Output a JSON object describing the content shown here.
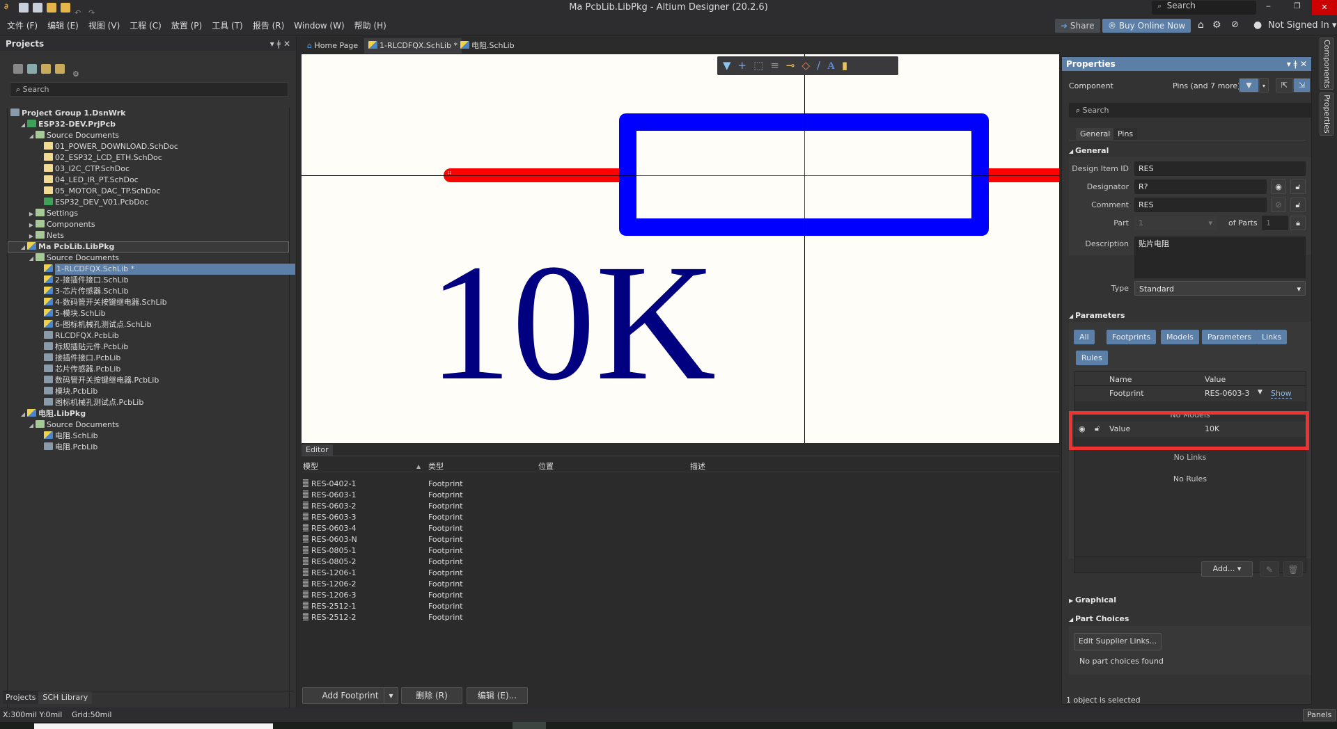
{
  "app": {
    "title": "Ma PcbLib.LibPkg - Altium Designer (20.2.6)",
    "search_placeholder": "Search"
  },
  "menu": [
    "文件 (F)",
    "编辑 (E)",
    "视图 (V)",
    "工程 (C)",
    "放置 (P)",
    "工具 (T)",
    "报告 (R)",
    "Window (W)",
    "帮助 (H)"
  ],
  "topbar": {
    "share": "Share",
    "buy": "Buy Online Now",
    "user": "Not Signed In"
  },
  "projects": {
    "title": "Projects",
    "search_placeholder": "Search",
    "tree": [
      {
        "label": "Project Group 1.DsnWrk",
        "level": 0,
        "icon": "project-group",
        "bold": true
      },
      {
        "label": "ESP32-DEV.PrjPcb",
        "level": 1,
        "icon": "pcb-project",
        "arrow": "open",
        "bold": true
      },
      {
        "label": "Source Documents",
        "level": 2,
        "icon": "folder",
        "arrow": "open"
      },
      {
        "label": "01_POWER_DOWNLOAD.SchDoc",
        "level": 3,
        "icon": "schdoc"
      },
      {
        "label": "02_ESP32_LCD_ETH.SchDoc",
        "level": 3,
        "icon": "schdoc"
      },
      {
        "label": "03_I2C_CTP.SchDoc",
        "level": 3,
        "icon": "schdoc"
      },
      {
        "label": "04_LED_IR_PT.SchDoc",
        "level": 3,
        "icon": "schdoc"
      },
      {
        "label": "05_MOTOR_DAC_TP.SchDoc",
        "level": 3,
        "icon": "schdoc"
      },
      {
        "label": "ESP32_DEV_V01.PcbDoc",
        "level": 3,
        "icon": "pcbdoc"
      },
      {
        "label": "Settings",
        "level": 2,
        "icon": "folder",
        "arrow": "closed"
      },
      {
        "label": "Components",
        "level": 2,
        "icon": "folder",
        "arrow": "closed"
      },
      {
        "label": "Nets",
        "level": 2,
        "icon": "folder",
        "arrow": "closed"
      },
      {
        "label": "Ma PcbLib.LibPkg",
        "level": 1,
        "icon": "libpkg",
        "arrow": "open",
        "bold": true,
        "outlined": true
      },
      {
        "label": "Source Documents",
        "level": 2,
        "icon": "folder",
        "arrow": "open"
      },
      {
        "label": "1-RLCDFQX.SchLib *",
        "level": 3,
        "icon": "schlib",
        "selected": true
      },
      {
        "label": "2-接插件接口.SchLib",
        "level": 3,
        "icon": "schlib"
      },
      {
        "label": "3-芯片传感器.SchLib",
        "level": 3,
        "icon": "schlib"
      },
      {
        "label": "4-数码管开关按键继电器.SchLib",
        "level": 3,
        "icon": "schlib"
      },
      {
        "label": "5-模块.SchLib",
        "level": 3,
        "icon": "schlib"
      },
      {
        "label": "6-图标机械孔测试点.SchLib",
        "level": 3,
        "icon": "schlib"
      },
      {
        "label": "RLCDFQX.PcbLib",
        "level": 3,
        "icon": "pcblib"
      },
      {
        "label": "标规插贴元件.PcbLib",
        "level": 3,
        "icon": "pcblib"
      },
      {
        "label": "接插件接口.PcbLib",
        "level": 3,
        "icon": "pcblib"
      },
      {
        "label": "芯片传感器.PcbLib",
        "level": 3,
        "icon": "pcblib"
      },
      {
        "label": "数码管开关按键继电器.PcbLib",
        "level": 3,
        "icon": "pcblib"
      },
      {
        "label": "模块.PcbLib",
        "level": 3,
        "icon": "pcblib"
      },
      {
        "label": "图标机械孔测试点.PcbLib",
        "level": 3,
        "icon": "pcblib"
      },
      {
        "label": "电阻.LibPkg",
        "level": 1,
        "icon": "libpkg",
        "arrow": "open",
        "bold": true
      },
      {
        "label": "Source Documents",
        "level": 2,
        "icon": "folder",
        "arrow": "open"
      },
      {
        "label": "电阻.SchLib",
        "level": 3,
        "icon": "schlib"
      },
      {
        "label": "电阻.PcbLib",
        "level": 3,
        "icon": "pcblib"
      }
    ],
    "bottom_tabs": [
      "Projects",
      "SCH Library"
    ]
  },
  "doc_tabs": [
    {
      "label": "Home Page",
      "icon": "home"
    },
    {
      "label": "1-RLCDFQX.SchLib *",
      "icon": "schlib",
      "active": true
    },
    {
      "label": "电阻.SchLib",
      "icon": "schlib"
    }
  ],
  "canvas": {
    "value_text": "10K",
    "colors": {
      "pin": "#ff0000",
      "body": "#0000ff",
      "text": "#000080"
    }
  },
  "editor": {
    "tab": "Editor",
    "columns": [
      "模型",
      "类型",
      "位置",
      "描述"
    ],
    "rows": [
      [
        "RES-0402-1",
        "Footprint"
      ],
      [
        "RES-0603-1",
        "Footprint"
      ],
      [
        "RES-0603-2",
        "Footprint"
      ],
      [
        "RES-0603-3",
        "Footprint"
      ],
      [
        "RES-0603-4",
        "Footprint"
      ],
      [
        "RES-0603-N",
        "Footprint"
      ],
      [
        "RES-0805-1",
        "Footprint"
      ],
      [
        "RES-0805-2",
        "Footprint"
      ],
      [
        "RES-1206-1",
        "Footprint"
      ],
      [
        "RES-1206-2",
        "Footprint"
      ],
      [
        "RES-1206-3",
        "Footprint"
      ],
      [
        "RES-2512-1",
        "Footprint"
      ],
      [
        "RES-2512-2",
        "Footprint"
      ]
    ],
    "add_footprint": "Add Footprint",
    "delete": "删除 (R)",
    "edit": "编辑 (E)..."
  },
  "properties": {
    "title": "Properties",
    "kind": "Component",
    "filter": "Pins (and 7 more)",
    "search_placeholder": "Search",
    "tabs": [
      "General",
      "Pins"
    ],
    "general": {
      "title": "General",
      "design_item_id_label": "Design Item ID",
      "design_item_id": "RES",
      "designator_label": "Designator",
      "designator": "R?",
      "comment_label": "Comment",
      "comment": "RES",
      "part_label": "Part",
      "part": "1",
      "of_parts_label": "of Parts",
      "of_parts": "1",
      "description_label": "Description",
      "description": "贴片电阻",
      "type_label": "Type",
      "type": "Standard"
    },
    "parameters": {
      "title": "Parameters",
      "filters": [
        "All",
        "Footprints",
        "Models",
        "Parameters",
        "Links",
        "Rules"
      ],
      "col_name": "Name",
      "col_value": "Value",
      "footprint_name": "Footprint",
      "footprint_value": "RES-0603-3",
      "show": "Show",
      "no_models": "No Models",
      "value_name": "Value",
      "value_value": "10K",
      "no_links": "No Links",
      "no_rules": "No Rules",
      "add": "Add..."
    },
    "graphical": "Graphical",
    "part_choices": "Part Choices",
    "edit_supplier": "Edit Supplier Links...",
    "no_part_choices": "No part choices found",
    "selection_status": "1 object is selected"
  },
  "side_tabs": [
    "Components",
    "Properties"
  ],
  "status": {
    "coords": "X:300mil Y:0mil",
    "grid": "Grid:50mil",
    "panels": "Panels"
  }
}
